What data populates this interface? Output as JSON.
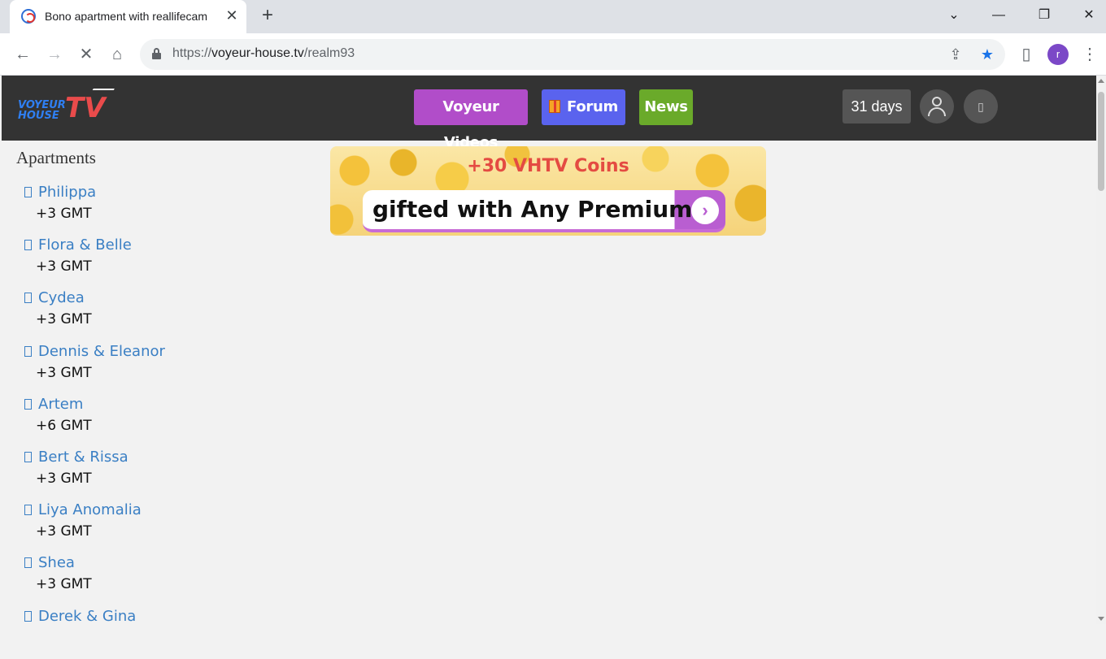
{
  "browser": {
    "tab_title": "Bono apartment with reallifecam",
    "url_scheme": "https://",
    "url_host": "voyeur-house.tv",
    "url_path": "/realm93",
    "profile_initial": "r"
  },
  "header": {
    "logo_line1": "VOYEUR",
    "logo_line2": "HOUSE",
    "logo_tv": "TV",
    "nav": {
      "videos": "Voyeur Videos",
      "forum": "Forum",
      "news": "News"
    },
    "days_badge": "31 days"
  },
  "sidebar": {
    "title": "Apartments",
    "apartments": [
      {
        "name": "Philippa",
        "tz": "+3 GMT"
      },
      {
        "name": "Flora & Belle",
        "tz": "+3 GMT"
      },
      {
        "name": "Cydea",
        "tz": "+3 GMT"
      },
      {
        "name": "Dennis & Eleanor",
        "tz": "+3 GMT"
      },
      {
        "name": "Artem",
        "tz": "+6 GMT"
      },
      {
        "name": "Bert & Rissa",
        "tz": "+3 GMT"
      },
      {
        "name": "Liya Anomalia",
        "tz": "+3 GMT"
      },
      {
        "name": "Shea",
        "tz": "+3 GMT"
      },
      {
        "name": "Derek & Gina",
        "tz": ""
      }
    ]
  },
  "banner": {
    "top_text": "+30 VHTV Coins",
    "main_text": "gifted with Any Premium"
  },
  "colors": {
    "videos_btn": "#b14dc9",
    "forum_btn": "#5a63ee",
    "news_btn": "#6aaa2a",
    "header_bg": "#333333",
    "link": "#3a7fc4"
  }
}
